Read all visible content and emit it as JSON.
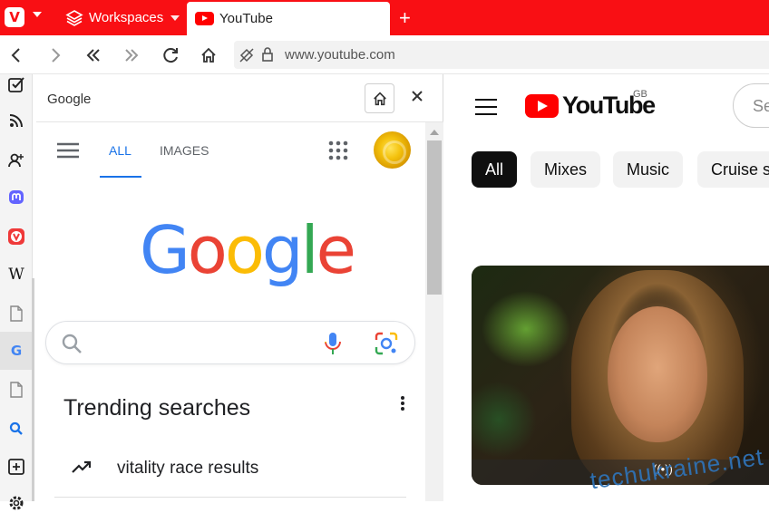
{
  "browser": {
    "workspaces_label": "Workspaces",
    "active_tab_title": "YouTube",
    "new_tab_label": "+",
    "url": "www.youtube.com"
  },
  "sidebar": {
    "icons": [
      "tasks-icon",
      "feed-icon",
      "contacts-icon",
      "mastodon-icon",
      "vivaldi-icon",
      "wikipedia-icon",
      "page-icon",
      "google-icon",
      "page-icon",
      "search-icon",
      "add-panel-icon",
      "settings-icon"
    ]
  },
  "web_panel": {
    "title": "Google",
    "google": {
      "tab_all": "ALL",
      "tab_images": "IMAGES",
      "logo": [
        "G",
        "o",
        "o",
        "g",
        "l",
        "e"
      ],
      "trending_title": "Trending searches",
      "trending_items": [
        "vitality race results"
      ]
    }
  },
  "youtube": {
    "brand": "YouTube",
    "region": "GB",
    "search_placeholder": "Se",
    "chips": [
      "All",
      "Mixes",
      "Music",
      "Cruise sh"
    ],
    "video_live_icon": "((•))"
  },
  "watermark": "techukraine.net",
  "colors": {
    "vivaldi_red": "#f90f14",
    "youtube_red": "#ff0000",
    "google_blue": "#4285f4",
    "google_red": "#ea4335",
    "google_yellow": "#fbbc05",
    "google_green": "#34a853",
    "link_blue": "#1a73e8"
  }
}
